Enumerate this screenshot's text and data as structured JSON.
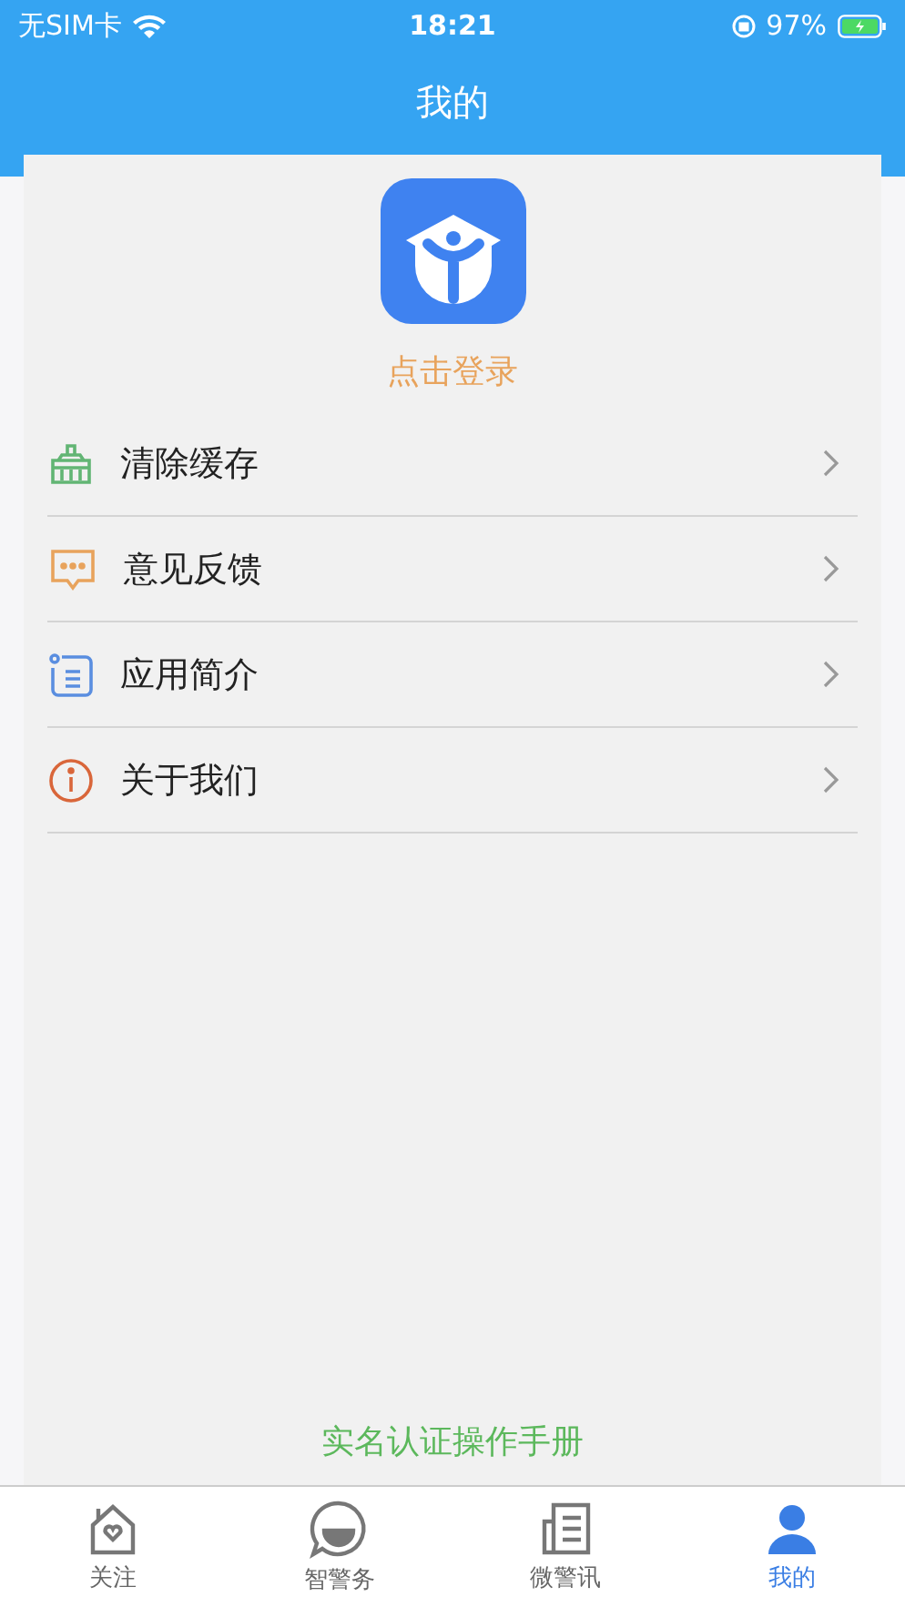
{
  "status_bar": {
    "carrier": "无SIM卡",
    "time": "18:21",
    "battery": "97%"
  },
  "header": {
    "title": "我的"
  },
  "profile": {
    "login": "点击登录"
  },
  "menu": [
    {
      "kind": "broom",
      "label": "清除缓存"
    },
    {
      "kind": "chat",
      "label": "意见反馈"
    },
    {
      "kind": "list",
      "label": "应用简介"
    },
    {
      "kind": "info",
      "label": "关于我们"
    }
  ],
  "footer_link": "实名认证操作手册",
  "tabs": [
    {
      "kind": "house",
      "label": "关注",
      "selected": false
    },
    {
      "kind": "bubble",
      "label": "智警务",
      "selected": false
    },
    {
      "kind": "news",
      "label": "微警讯",
      "selected": false
    },
    {
      "kind": "person",
      "label": "我的",
      "selected": true
    }
  ]
}
